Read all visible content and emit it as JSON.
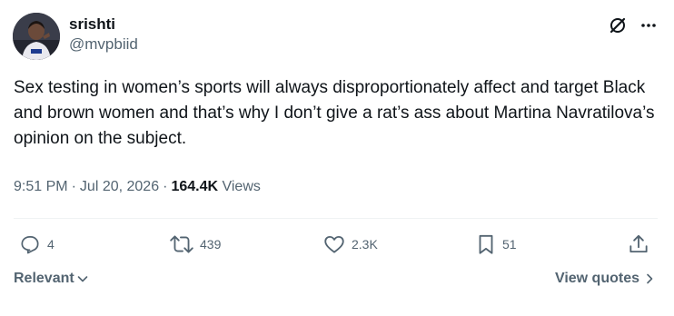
{
  "author": {
    "display_name": "srishti",
    "handle": "@mvpbiid"
  },
  "tweet": {
    "text": "Sex testing in women’s sports will always disproportionately affect and target Black and brown women and that’s why I don’t give a rat’s ass about Martina Navratilova’s opinion on the subject.",
    "time": "9:51 PM",
    "date": "Jul 20, 2026",
    "views_count": "164.4K",
    "views_label": "Views"
  },
  "actions": {
    "replies": "4",
    "reposts": "439",
    "likes": "2.3K",
    "bookmarks": "51"
  },
  "footer": {
    "sort_label": "Relevant",
    "view_quotes_label": "View quotes"
  },
  "icons": {
    "grok": "grok-icon",
    "more": "more-icon",
    "reply": "reply-icon",
    "repost": "repost-icon",
    "like": "like-icon",
    "bookmark": "bookmark-icon",
    "share": "share-icon"
  },
  "colors": {
    "text_primary": "#0f1419",
    "text_secondary": "#536471",
    "divider": "#eff3f4"
  }
}
